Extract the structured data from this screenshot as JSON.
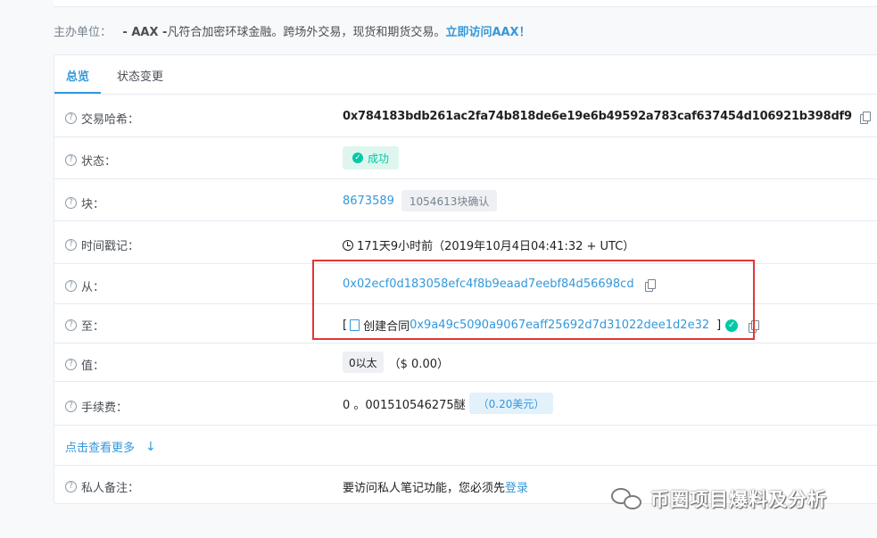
{
  "sponsor": {
    "label": "主办单位：",
    "brand": "- AAX -",
    "desc": "凡符合加密环球金融。跨场外交易，现货和期货交易。",
    "cta": "立即访问AAX！"
  },
  "tabs": [
    {
      "label": "总览",
      "active": true
    },
    {
      "label": "状态变更",
      "active": false
    }
  ],
  "rows": {
    "tx_hash": {
      "label": "交易哈希：",
      "value": "0x784183bdb261ac2fa74b818de6e19e6b49592a783caf637454d106921b398df9"
    },
    "status": {
      "label": "状态：",
      "value": "成功"
    },
    "block": {
      "label": "块：",
      "value": "8673589",
      "confirmations": "1054613块确认"
    },
    "timestamp": {
      "label": "时间戳记：",
      "value": "171天9小时前（2019年10月4日04:41:32 + UTC）"
    },
    "from": {
      "label": "从：",
      "value": "0x02ecf0d183058efc4f8b9eaad7eebf84d56698cd"
    },
    "to": {
      "label": "至：",
      "bracket_open": "[",
      "created_text": "创建合同",
      "contract": "0x9a49c5090a9067eaff25692d7d31022dee1d2e32",
      "bracket_close": "]"
    },
    "value": {
      "label": "值：",
      "amount": "0以太",
      "usd": "（$ 0.00）"
    },
    "fee": {
      "label": "手续费：",
      "amount": "0 。001510546275醚",
      "usd": "（0.20美元）"
    },
    "more": {
      "label": "点击查看更多"
    },
    "note": {
      "label": "私人备注：",
      "text": "要访问私人笔记功能，您必须先",
      "login": "登录"
    }
  },
  "icons": {
    "question": "question-circle-icon",
    "copy": "copy-icon",
    "clock": "clock-icon",
    "check": "check-circle-icon",
    "contract": "contract-icon",
    "arrow": "arrow-down-icon",
    "wechat": "wechat-logo-icon"
  },
  "watermark": {
    "text": "币圈项目爆料及分析"
  },
  "colors": {
    "accent": "#3498db",
    "success": "#00c9a7",
    "highlight": "#e23636"
  }
}
